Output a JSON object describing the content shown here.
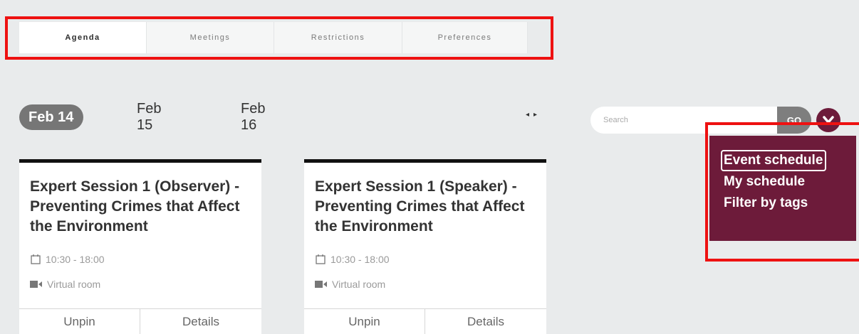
{
  "tabs": [
    {
      "label": "Agenda",
      "active": true
    },
    {
      "label": "Meetings",
      "active": false
    },
    {
      "label": "Restrictions",
      "active": false
    },
    {
      "label": "Preferences",
      "active": false
    }
  ],
  "dates": [
    {
      "label": "Feb 14",
      "active": true
    },
    {
      "label": "Feb 15",
      "active": false
    },
    {
      "label": "Feb 16",
      "active": false
    }
  ],
  "nav_arrows": {
    "prev": "◂",
    "next": "▸"
  },
  "search": {
    "placeholder": "Search",
    "go_label": "GO"
  },
  "menu": {
    "items": [
      {
        "label": "Event schedule",
        "focused": true
      },
      {
        "label": "My schedule",
        "focused": false
      },
      {
        "label": "Filter by tags",
        "focused": false
      }
    ]
  },
  "cards": [
    {
      "title": "Expert Session 1 (Observer) - Preventing Crimes that Affect the Environment",
      "time": "10:30 - 18:00",
      "location": "Virtual room",
      "actions": [
        "Unpin",
        "Details"
      ]
    },
    {
      "title": "Expert Session 1 (Speaker) - Preventing Crimes that Affect the Environment",
      "time": "10:30 - 18:00",
      "location": "Virtual room",
      "actions": [
        "Unpin",
        "Details"
      ]
    }
  ],
  "colors": {
    "accent": "#6d1b3a",
    "highlight": "#ee1111",
    "active_date_bg": "#767676",
    "page_bg": "#e9ebec"
  }
}
